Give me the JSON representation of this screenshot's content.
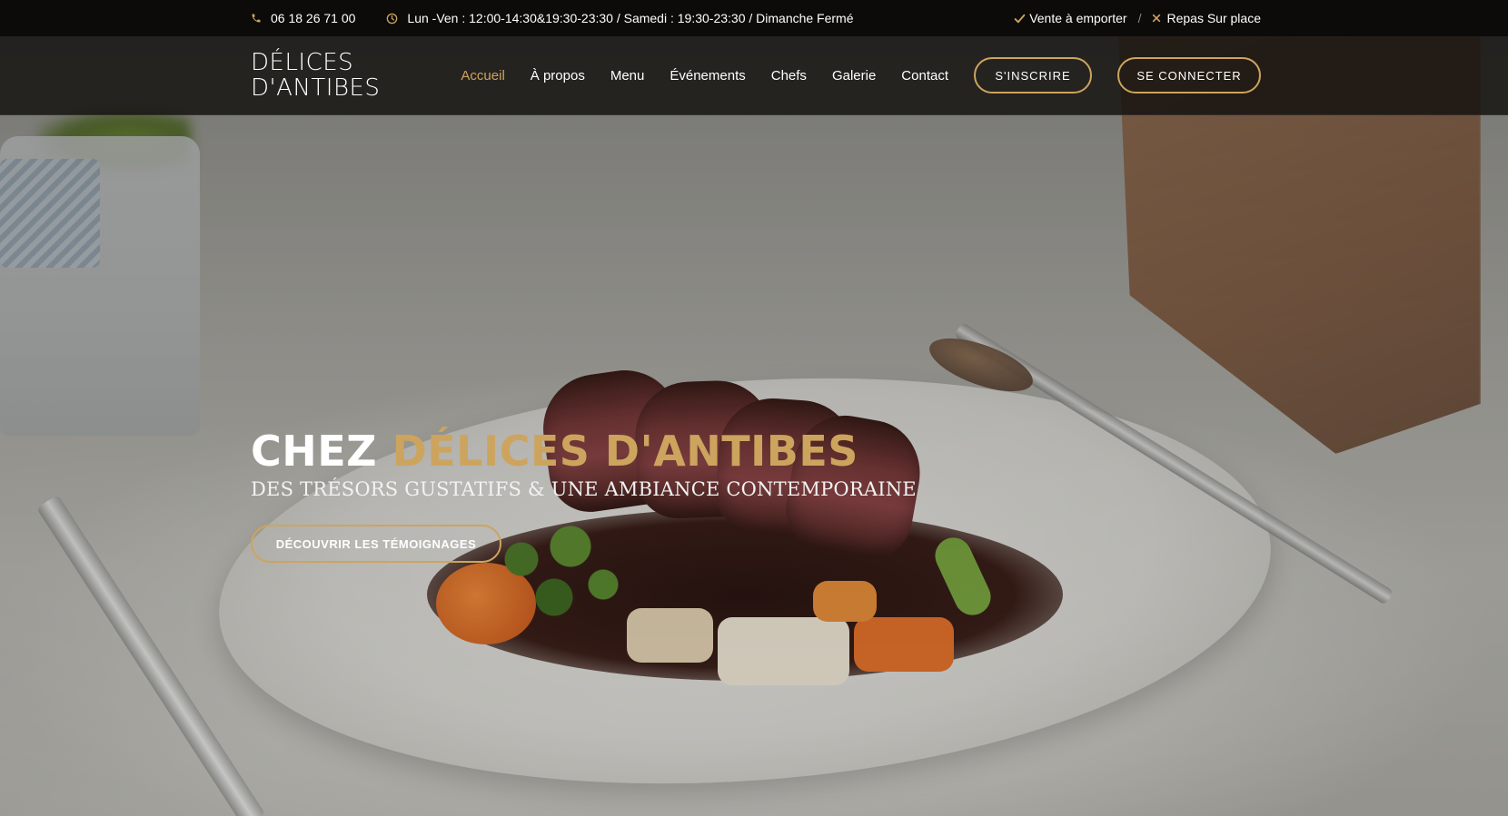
{
  "topbar": {
    "phone": "06 18 26 71 00",
    "hours": "Lun -Ven : 12:00-14:30&19:30-23:30 / Samedi : 19:30-23:30 / Dimanche Fermé",
    "takeaway": "Vente à emporter",
    "separator": "/",
    "dine_in": "Repas Sur place"
  },
  "logo": {
    "line1": "DÉLICES",
    "line2": "D'ANTIBES"
  },
  "nav": {
    "links": [
      "Accueil",
      "À propos",
      "Menu",
      "Événements",
      "Chefs",
      "Galerie",
      "Contact"
    ],
    "active": "Accueil",
    "signup": "S'INSCRIRE",
    "login": "SE CONNECTER"
  },
  "hero": {
    "title_prefix": "CHEZ ",
    "title_accent": "DÉLICES D'ANTIBES",
    "subtitle": "DES TRÉSORS GUSTATIFS & UNE AMBIANCE CONTEMPORAINE",
    "cta": "DÉCOUVRIR LES TÉMOIGNAGES"
  },
  "icons": {
    "phone": "phone-icon",
    "clock": "clock-icon",
    "check": "check-icon",
    "cross": "close-icon"
  },
  "colors": {
    "accent": "#cda45e",
    "topbar_bg": "#0c0b09"
  }
}
